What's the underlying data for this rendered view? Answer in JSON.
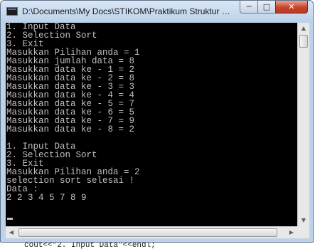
{
  "window": {
    "title": "D:\\Documents\\My Docs\\STIKOM\\Praktikum Struktur Data\\s...",
    "controls": {
      "minimize": "─",
      "maximize": "□",
      "close": "✕"
    }
  },
  "console": {
    "lines": [
      "1. Input Data",
      "2. Selection Sort",
      "3. Exit",
      "Masukkan Pilihan anda = 1",
      "Masukkan jumlah data = 8",
      "Masukkan data ke - 1 = 2",
      "Masukkan data ke - 2 = 8",
      "Masukkan data ke - 3 = 3",
      "Masukkan data ke - 4 = 4",
      "Masukkan data ke - 5 = 7",
      "Masukkan data ke - 6 = 5",
      "Masukkan data ke - 7 = 9",
      "Masukkan data ke - 8 = 2",
      "",
      "1. Input Data",
      "2. Selection Sort",
      "3. Exit",
      "Masukkan Pilihan anda = 2",
      "selection sort selesai !",
      "Data :",
      "2 2 3 4 5 7 8 9"
    ]
  },
  "scrollbars": {
    "up_arrow": "▲",
    "down_arrow": "▼",
    "left_arrow": "◀",
    "right_arrow": "▶"
  },
  "background_code": "cout<<\"2. Input Data\"<<endl;",
  "colors": {
    "console_bg": "#000000",
    "console_text": "#c0c0c0",
    "close_button": "#c8432a",
    "title_bar": "#bcd2ea"
  }
}
